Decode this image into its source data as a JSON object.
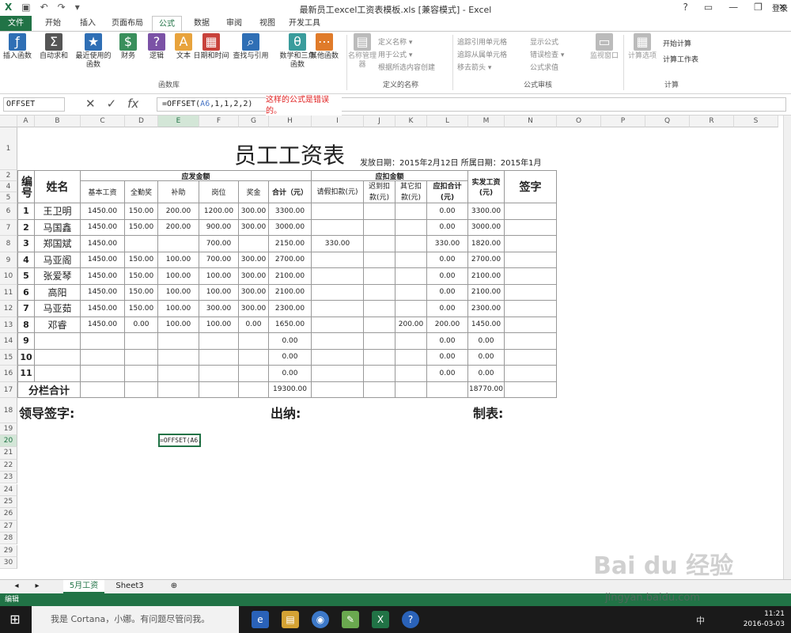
{
  "window": {
    "title": "最新员工excel工资表模板.xls  [兼容模式] - Excel",
    "login": "登录",
    "help": "?"
  },
  "ribbon_tabs": [
    "文件",
    "开始",
    "插入",
    "页面布局",
    "公式",
    "数据",
    "审阅",
    "视图",
    "开发工具"
  ],
  "active_tab": "公式",
  "ribbon": {
    "function_library": {
      "label": "函数库",
      "buttons": [
        {
          "label": "插入函数",
          "icon": "fx-icon",
          "color": "#2f6fb5"
        },
        {
          "label": "自动求和",
          "icon": "sigma-icon",
          "color": "#555555"
        },
        {
          "label": "最近使用的函数",
          "icon": "star-icon",
          "color": "#2f6fb5"
        },
        {
          "label": "财务",
          "icon": "finance-icon",
          "color": "#3a8f5c"
        },
        {
          "label": "逻辑",
          "icon": "logic-icon",
          "color": "#7b52a6"
        },
        {
          "label": "文本",
          "icon": "text-icon",
          "color": "#e8a33c"
        },
        {
          "label": "日期和时间",
          "icon": "calendar-icon",
          "color": "#c8423b"
        },
        {
          "label": "查找与引用",
          "icon": "lookup-icon",
          "color": "#2f6fb5"
        },
        {
          "label": "数学和三角函数",
          "icon": "theta-icon",
          "color": "#3a9c9c"
        },
        {
          "label": "其他函数",
          "icon": "more-functions-icon",
          "color": "#e07b2a"
        }
      ]
    },
    "defined_names": {
      "label": "定义的名称",
      "manager": "名称管理器",
      "items": [
        "定义名称 ▾",
        "用于公式 ▾",
        "根据所选内容创建"
      ]
    },
    "formula_auditing": {
      "label": "公式审核",
      "items": [
        "追踪引用单元格",
        "追踪从属单元格",
        "移去箭头 ▾",
        "显示公式",
        "错误检查 ▾",
        "公式求值"
      ],
      "watch": "监视窗口"
    },
    "calculation": {
      "label": "计算",
      "options": "计算选项",
      "items": [
        "开始计算",
        "计算工作表"
      ]
    }
  },
  "formula_bar": {
    "name_box": "OFFSET",
    "formula_prefix": "=OFFSET(",
    "formula_ref": "A6",
    "formula_suffix": ",1,1,2,2)",
    "note": "这样的公式是错误的。"
  },
  "sheet": {
    "columns": [
      "A",
      "B",
      "C",
      "D",
      "E",
      "F",
      "G",
      "H",
      "I",
      "J",
      "K",
      "L",
      "M",
      "N",
      "O",
      "P",
      "Q",
      "R",
      "S"
    ],
    "title": "员工工资表",
    "date_line": "发放日期：2015年2月12日 所属日期：2015年1月",
    "headers": {
      "no": "编号",
      "name": "姓名",
      "pay_group": "应发金额",
      "deduct_group": "应扣金额",
      "net": "实发工资(元)",
      "sign": "签字",
      "pay_cols": [
        "基本工资",
        "全勤奖",
        "补助",
        "岗位",
        "奖金",
        "合计（元）"
      ],
      "deduct_cols": [
        "请假扣款(元)",
        "迟到扣款(元)",
        "其它扣款(元)",
        "应扣合计(元)"
      ]
    },
    "rows": [
      {
        "no": "1",
        "name": "王卫明",
        "base": "1450.00",
        "attend": "150.00",
        "subsidy": "200.00",
        "post": "1200.00",
        "bonus": "300.00",
        "total": "3300.00",
        "leave": "",
        "late": "",
        "other": "",
        "deduct": "0.00",
        "net": "3300.00"
      },
      {
        "no": "2",
        "name": "马国鑫",
        "base": "1450.00",
        "attend": "150.00",
        "subsidy": "200.00",
        "post": "900.00",
        "bonus": "300.00",
        "total": "3000.00",
        "leave": "",
        "late": "",
        "other": "",
        "deduct": "0.00",
        "net": "3000.00"
      },
      {
        "no": "3",
        "name": "郑国斌",
        "base": "1450.00",
        "attend": "",
        "subsidy": "",
        "post": "700.00",
        "bonus": "",
        "total": "2150.00",
        "leave": "330.00",
        "late": "",
        "other": "",
        "deduct": "330.00",
        "net": "1820.00"
      },
      {
        "no": "4",
        "name": "马亚阁",
        "base": "1450.00",
        "attend": "150.00",
        "subsidy": "100.00",
        "post": "700.00",
        "bonus": "300.00",
        "total": "2700.00",
        "leave": "",
        "late": "",
        "other": "",
        "deduct": "0.00",
        "net": "2700.00"
      },
      {
        "no": "5",
        "name": "张爱琴",
        "base": "1450.00",
        "attend": "150.00",
        "subsidy": "100.00",
        "post": "100.00",
        "bonus": "300.00",
        "total": "2100.00",
        "leave": "",
        "late": "",
        "other": "",
        "deduct": "0.00",
        "net": "2100.00"
      },
      {
        "no": "6",
        "name": "高阳",
        "base": "1450.00",
        "attend": "150.00",
        "subsidy": "100.00",
        "post": "100.00",
        "bonus": "300.00",
        "total": "2100.00",
        "leave": "",
        "late": "",
        "other": "",
        "deduct": "0.00",
        "net": "2100.00"
      },
      {
        "no": "7",
        "name": "马亚茹",
        "base": "1450.00",
        "attend": "150.00",
        "subsidy": "100.00",
        "post": "300.00",
        "bonus": "300.00",
        "total": "2300.00",
        "leave": "",
        "late": "",
        "other": "",
        "deduct": "0.00",
        "net": "2300.00"
      },
      {
        "no": "8",
        "name": "邓睿",
        "base": "1450.00",
        "attend": "0.00",
        "subsidy": "100.00",
        "post": "100.00",
        "bonus": "0.00",
        "total": "1650.00",
        "leave": "",
        "late": "",
        "other": "200.00",
        "deduct": "200.00",
        "net": "1450.00"
      },
      {
        "no": "9",
        "name": "",
        "base": "",
        "attend": "",
        "subsidy": "",
        "post": "",
        "bonus": "",
        "total": "0.00",
        "leave": "",
        "late": "",
        "other": "",
        "deduct": "0.00",
        "net": "0.00"
      },
      {
        "no": "10",
        "name": "",
        "base": "",
        "attend": "",
        "subsidy": "",
        "post": "",
        "bonus": "",
        "total": "0.00",
        "leave": "",
        "late": "",
        "other": "",
        "deduct": "0.00",
        "net": "0.00"
      },
      {
        "no": "11",
        "name": "",
        "base": "",
        "attend": "",
        "subsidy": "",
        "post": "",
        "bonus": "",
        "total": "0.00",
        "leave": "",
        "late": "",
        "other": "",
        "deduct": "0.00",
        "net": "0.00"
      }
    ],
    "subtotal_label": "分栏合计",
    "subtotal_total": "19300.00",
    "subtotal_net": "18770.00",
    "signoff": [
      "领导签字:",
      "出纳:",
      "制表:"
    ],
    "editing_cell": "=OFFSET(A6,"
  },
  "sheet_tabs": [
    "5月工资",
    "Sheet3"
  ],
  "active_sheet": "5月工资",
  "status": "编辑",
  "taskbar": {
    "cortana": "我是 Cortana，小娜。有问题尽管问我。",
    "time": "11:21",
    "date": "2016-03-03",
    "tray": "中"
  },
  "watermark": {
    "main": "Bai du 经验",
    "url": "jingyan.baidu.com"
  }
}
